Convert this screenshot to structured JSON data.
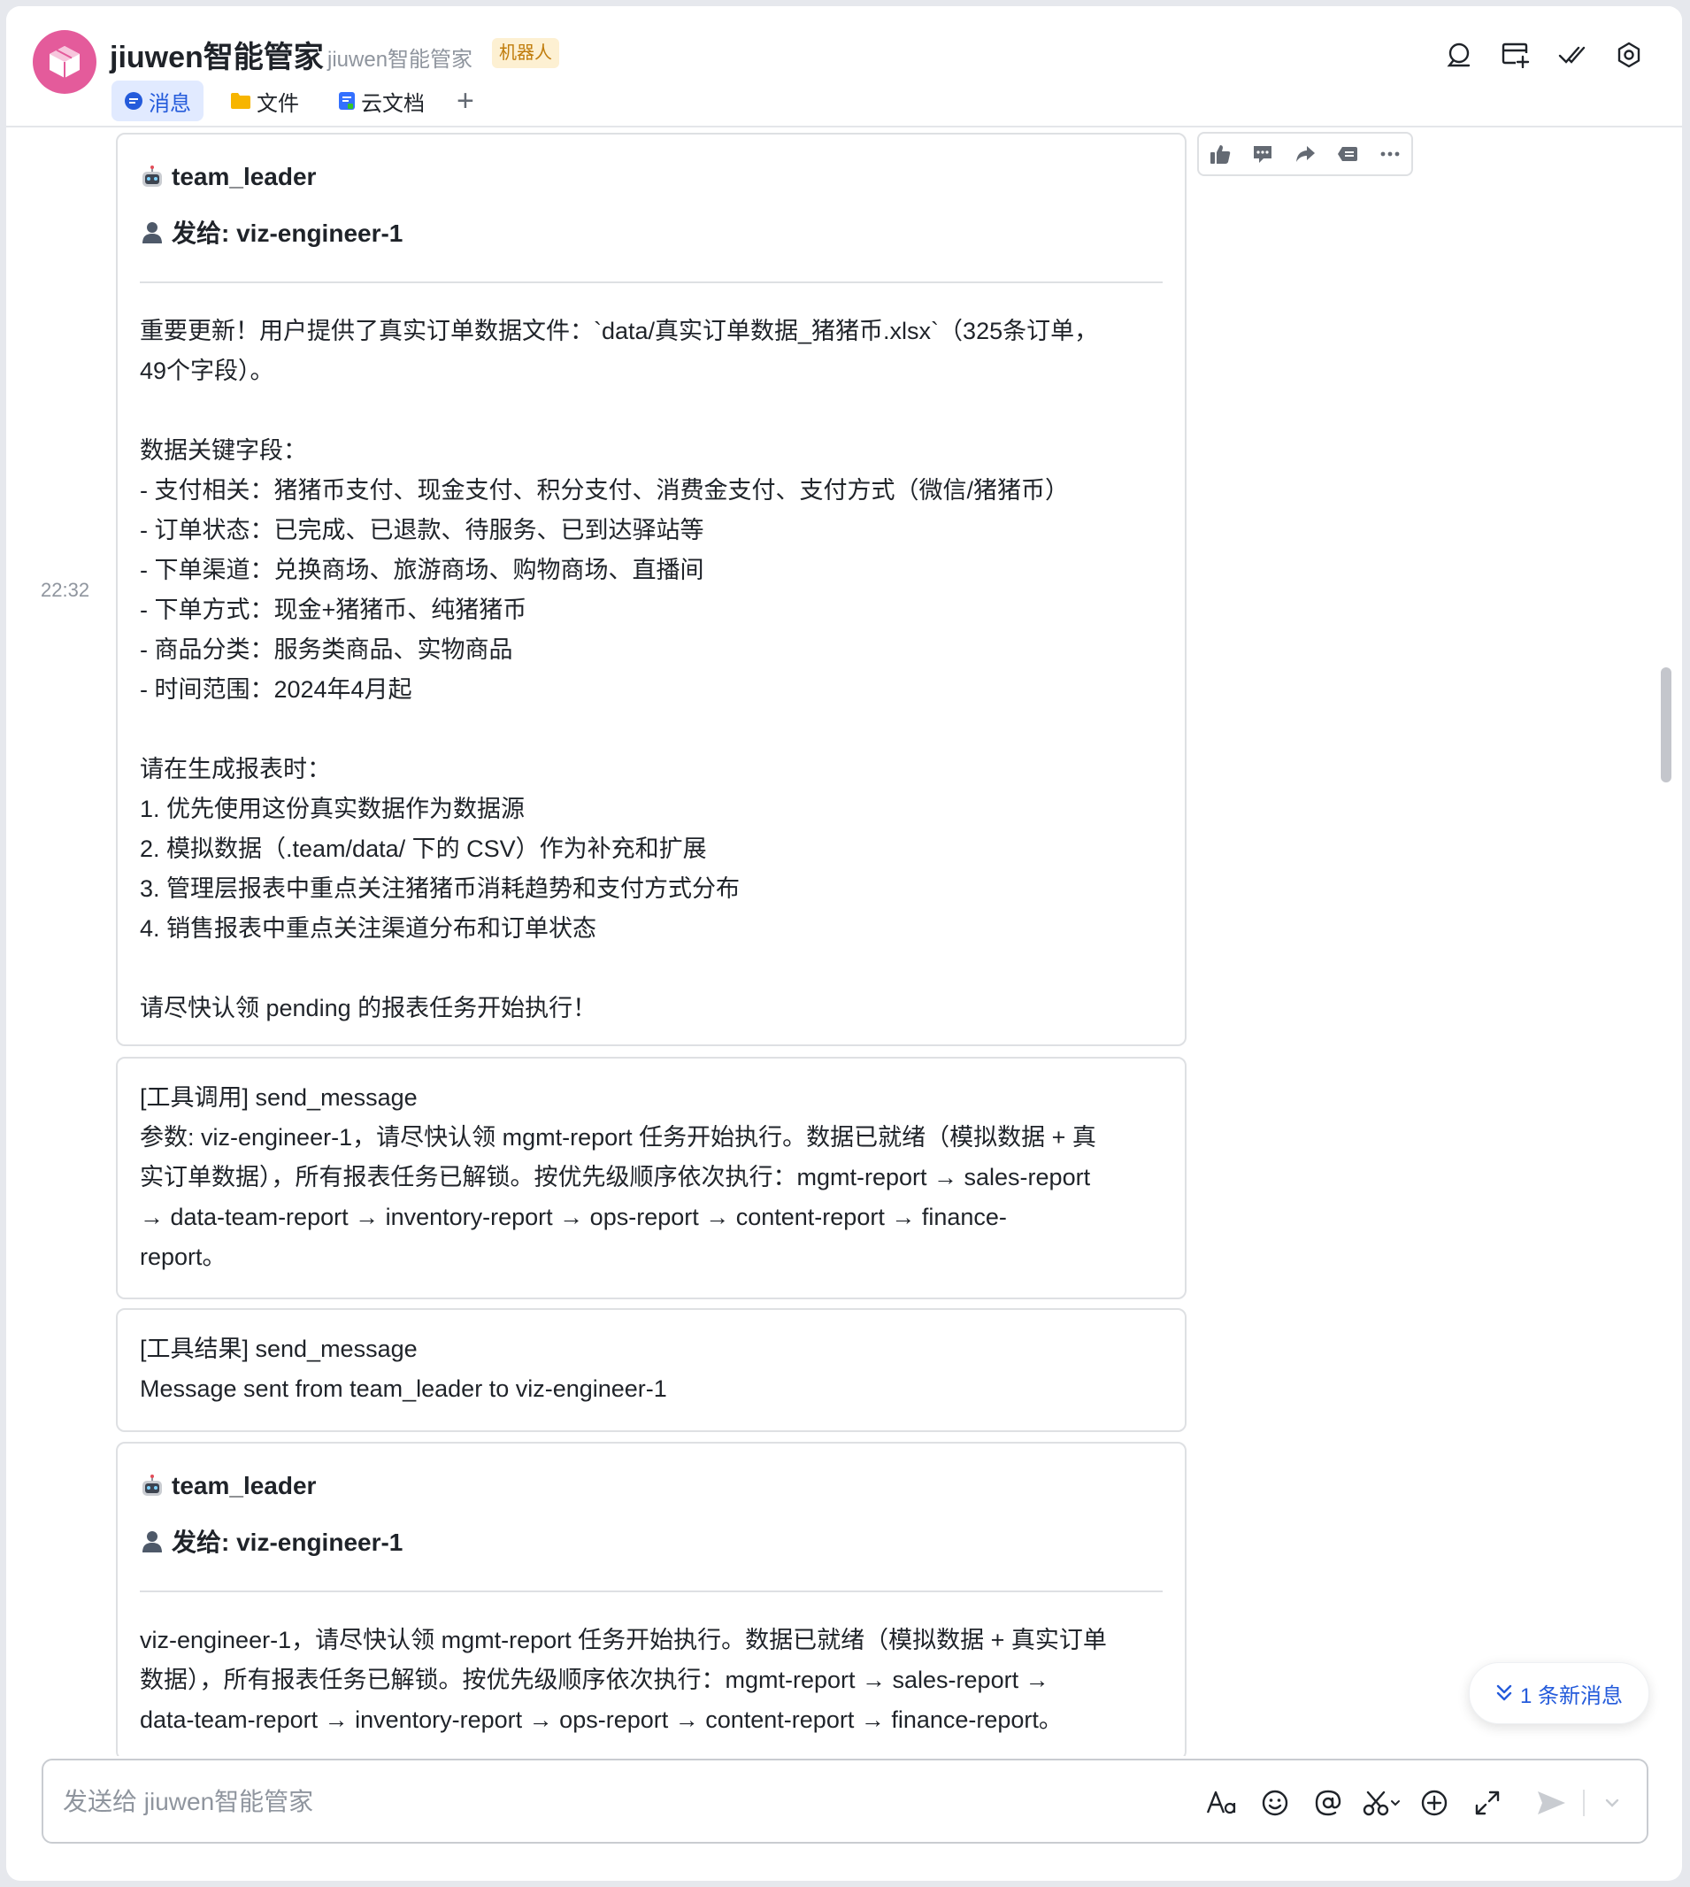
{
  "header": {
    "title": "jiuwen智能管家",
    "subtitle": "jiuwen智能管家",
    "badge": "机器人",
    "tabs": [
      {
        "label": "消息",
        "icon": "chat-bubble-icon",
        "active": true
      },
      {
        "label": "文件",
        "icon": "folder-icon",
        "active": false
      },
      {
        "label": "云文档",
        "icon": "document-icon",
        "active": false
      }
    ],
    "add_tab": "+",
    "actions": [
      "search-icon",
      "add-screen-icon",
      "check-all-icon",
      "settings-icon"
    ]
  },
  "chat": {
    "timestamp": "22:32",
    "messages": [
      {
        "sender": "team_leader",
        "recipient": "发给: viz-engineer-1",
        "body": "重要更新！用户提供了真实订单数据文件：`data/真实订单数据_猪猪币.xlsx`（325条订单，\n49个字段）。\n\n数据关键字段：\n- 支付相关：猪猪币支付、现金支付、积分支付、消费金支付、支付方式（微信/猪猪币）\n- 订单状态：已完成、已退款、待服务、已到达驿站等\n- 下单渠道：兑换商场、旅游商场、购物商场、直播间\n- 下单方式：现金+猪猪币、纯猪猪币\n- 商品分类：服务类商品、实物商品\n- 时间范围：2024年4月起\n\n请在生成报表时：\n1. 优先使用这份真实数据作为数据源\n2. 模拟数据（.team/data/ 下的 CSV）作为补充和扩展\n3. 管理层报表中重点关注猪猪币消耗趋势和支付方式分布\n4. 销售报表中重点关注渠道分布和订单状态\n\n请尽快认领 pending 的报表任务开始执行！"
      },
      {
        "body": "[工具调用] send_message\n参数: viz-engineer-1，请尽快认领 mgmt-report 任务开始执行。数据已就绪（模拟数据 + 真\n实订单数据），所有报表任务已解锁。按优先级顺序依次执行：mgmt-report → sales-report\n→ data-team-report → inventory-report → ops-report → content-report → finance-\nreport。"
      },
      {
        "body": "[工具结果] send_message\nMessage sent from team_leader to viz-engineer-1"
      },
      {
        "sender": "team_leader",
        "recipient": "发给: viz-engineer-1",
        "body": "viz-engineer-1，请尽快认领 mgmt-report 任务开始执行。数据已就绪（模拟数据 + 真实订单\n数据），所有报表任务已解锁。按优先级顺序依次执行：mgmt-report → sales-report →\ndata-team-report → inventory-report → ops-report → content-report → finance-report。"
      }
    ],
    "reactions": [
      "thumbs-up-icon",
      "comment-icon",
      "forward-icon",
      "quote-icon",
      "more-icon"
    ],
    "new_messages": "1 条新消息"
  },
  "composer": {
    "placeholder": "发送给 jiuwen智能管家",
    "value": "",
    "tools": [
      "font-format-icon",
      "emoji-icon",
      "mention-icon",
      "screenshot-icon",
      "add-icon",
      "expand-icon",
      "send-icon",
      "dropdown-icon"
    ]
  },
  "colors": {
    "accent": "#245bdb",
    "avatar": "#e45b9b",
    "badge_bg": "#fdf0d2",
    "badge_text": "#c07c0b"
  }
}
